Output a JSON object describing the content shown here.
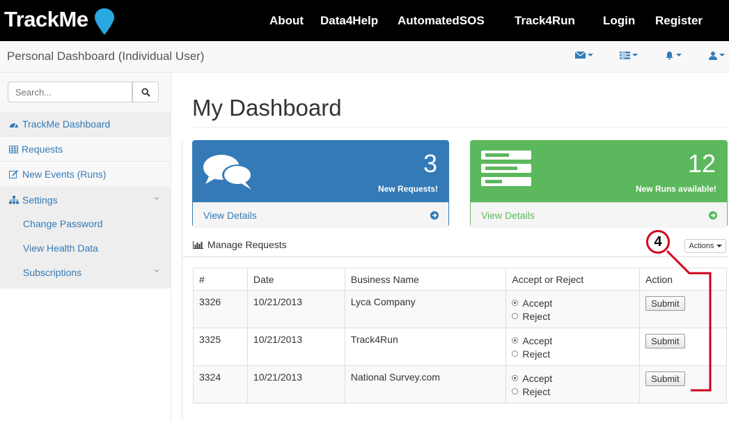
{
  "topbar": {
    "brand": "TrackMe",
    "nav": [
      "About",
      "Data4Help",
      "AutomatedSOS",
      "Track4Run",
      "Login",
      "Register"
    ]
  },
  "subbar": {
    "title": "Personal Dashboard (Individual User)"
  },
  "sidebar": {
    "search_placeholder": "Search...",
    "items": [
      {
        "label": "TrackMe Dashboard",
        "icon": "dashboard-icon"
      },
      {
        "label": "Requests",
        "icon": "table-icon"
      },
      {
        "label": "New Events (Runs)",
        "icon": "edit-icon"
      },
      {
        "label": "Settings",
        "icon": "sitemap-icon"
      }
    ],
    "sub_items": [
      "Change Password",
      "View Health Data",
      "Subscriptions"
    ]
  },
  "main": {
    "title": "My Dashboard",
    "panels": [
      {
        "count": "3",
        "caption": "New Requests!",
        "link": "View Details",
        "color": "#337ab7"
      },
      {
        "count": "12",
        "caption": "New Runs available!",
        "link": "View Details",
        "color": "#5cb85c"
      }
    ],
    "manage_label": "Manage Requests",
    "actions_label": "Actions",
    "table": {
      "headers": [
        "#",
        "Date",
        "Business Name",
        "Accept or Reject",
        "Action"
      ],
      "rows": [
        {
          "id": "3326",
          "date": "10/21/2013",
          "business": "Lyca Company",
          "accept": "Accept",
          "reject": "Reject",
          "action": "Submit"
        },
        {
          "id": "3325",
          "date": "10/21/2013",
          "business": "Track4Run",
          "accept": "Accept",
          "reject": "Reject",
          "action": "Submit"
        },
        {
          "id": "3324",
          "date": "10/21/2013",
          "business": "National Survey.com",
          "accept": "Accept",
          "reject": "Reject",
          "action": "Submit"
        }
      ]
    }
  },
  "annotation": {
    "label": "4",
    "color": "#d0021b"
  }
}
